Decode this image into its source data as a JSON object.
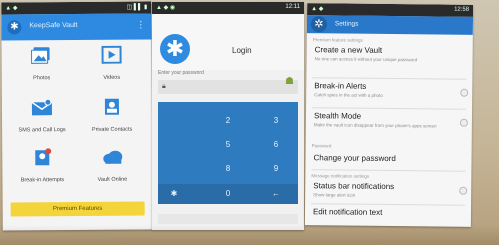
{
  "phone1": {
    "title": "KeepSafe Vault",
    "tiles": [
      {
        "label": "Photos"
      },
      {
        "label": "Videos"
      },
      {
        "label": "SMS and Call Logs"
      },
      {
        "label": "Private Contacts"
      },
      {
        "label": "Break-in Attempts"
      },
      {
        "label": "Vault Online"
      }
    ],
    "premium_label": "Premium Features",
    "accent": "#2d8ae0"
  },
  "phone2": {
    "title": "Login",
    "prompt": "Enter your password",
    "keys": [
      "2",
      "3",
      "5",
      "6",
      "8",
      "9",
      "0",
      "←"
    ],
    "accent": "#2f7bbf"
  },
  "phone3": {
    "title": "Settings",
    "sections": {
      "top": "Premium feature settings",
      "password": "Password",
      "notification": "Message notification settings"
    },
    "items": [
      {
        "title": "Create a new Vault",
        "desc": "No one can access it without your unique password"
      },
      {
        "title": "Break-in Alerts",
        "desc": "Catch spies in the act with a photo"
      },
      {
        "title": "Stealth Mode",
        "desc": "Make the vault icon disappear from your phone's apps screen"
      },
      {
        "title": "Change your password",
        "desc": ""
      },
      {
        "title": "Status bar notifications",
        "desc": "Show large alert icon"
      },
      {
        "title": "Edit notification text",
        "desc": ""
      }
    ],
    "accent": "#2a78c9"
  },
  "status": {
    "time1": "12:11",
    "time2": "12:58"
  }
}
